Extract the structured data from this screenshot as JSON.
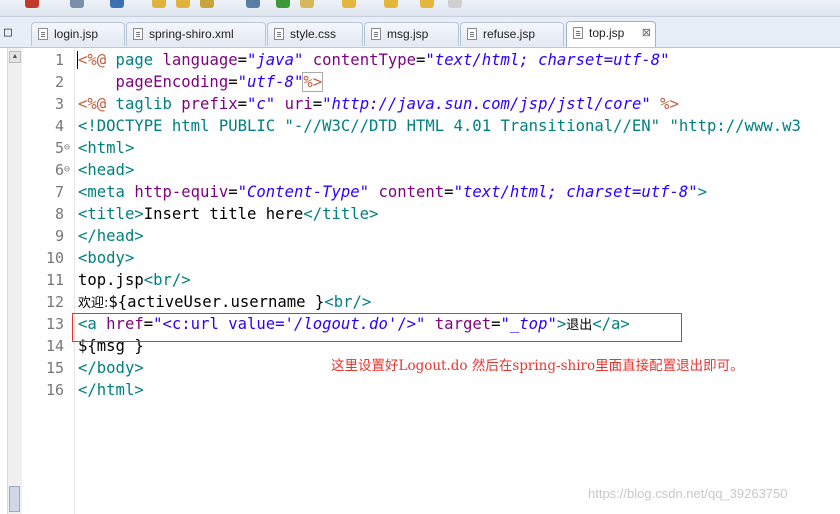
{
  "editor": {
    "tabs": [
      {
        "label": "login.jsp",
        "active": false
      },
      {
        "label": "spring-shiro.xml",
        "active": false
      },
      {
        "label": "style.css",
        "active": false
      },
      {
        "label": "msg.jsp",
        "active": false
      },
      {
        "label": "refuse.jsp",
        "active": false
      },
      {
        "label": "top.jsp",
        "active": true
      }
    ],
    "close_glyph": "⊠",
    "left_panel_glyph": "□",
    "line_numbers": [
      "1",
      "2",
      "3",
      "4",
      "5",
      "6",
      "7",
      "8",
      "9",
      "10",
      "11",
      "12",
      "13",
      "14",
      "15",
      "16"
    ],
    "fold_marker": "⊖",
    "lines": {
      "l1": {
        "t1": "<%@",
        "t2": " page ",
        "t3": "language",
        "t4": "=",
        "t5": "\"java\"",
        "t6": " contentType",
        "t7": "=",
        "t8": "\"text/html; charset=utf-8\""
      },
      "l2": {
        "t1": "    pageEncoding",
        "t2": "=",
        "t3": "\"utf-8\"",
        "t4": "%>"
      },
      "l3": {
        "t1": "<%@",
        "t2": " taglib ",
        "t3": "prefix",
        "t4": "=",
        "t5": "\"c\"",
        "t6": " uri",
        "t7": "=",
        "t8": "\"http://java.sun.com/jsp/jstl/core\"",
        "t9": " %>"
      },
      "l4": {
        "t1": "<!DOCTYPE html PUBLIC \"-//W3C//DTD HTML 4.01 Transitional//EN\" \"http://www.w3"
      },
      "l5": {
        "t1": "<html>"
      },
      "l6": {
        "t1": "<head>"
      },
      "l7": {
        "t1": "<meta ",
        "t2": "http-equiv",
        "t3": "=",
        "t4": "\"Content-Type\"",
        "t5": " content",
        "t6": "=",
        "t7": "\"text/html; charset=utf-8\"",
        "t8": ">"
      },
      "l8": {
        "t1": "<title>",
        "t2": "Insert title here",
        "t3": "</title>"
      },
      "l9": {
        "t1": "</head>"
      },
      "l10": {
        "t1": "<body>"
      },
      "l11": {
        "t1": "top.jsp",
        "t2": "<br/>"
      },
      "l12": {
        "t1": "欢迎:",
        "t2": "${activeUser.username }",
        "t3": "<br/>"
      },
      "l13": {
        "t1": "<a ",
        "t2": "href",
        "t3": "=",
        "t4": "\"<c:url value='",
        "t5": "/logout.do",
        "t6": "'/>\"",
        "t7": " target",
        "t8": "=",
        "t9": "\"_top\"",
        "t10": ">",
        "t11": "退出",
        "t12": "</a>"
      },
      "l14": {
        "t1": "${msg }"
      },
      "l15": {
        "t1": "</body>"
      },
      "l16": {
        "t1": "</html>"
      }
    }
  },
  "annotation": {
    "note": "这里设置好Logout.do 然后在spring-shiro里面直接配置退出即可。",
    "color": "#e8342e"
  },
  "watermark": "https://blog.csdn.net/qq_39263750",
  "colors": {
    "tag": "#008080",
    "attribute": "#7f007f",
    "string": "#2a00ff",
    "jsp_directive": "#bf5f3f",
    "line_number": "#787878"
  }
}
